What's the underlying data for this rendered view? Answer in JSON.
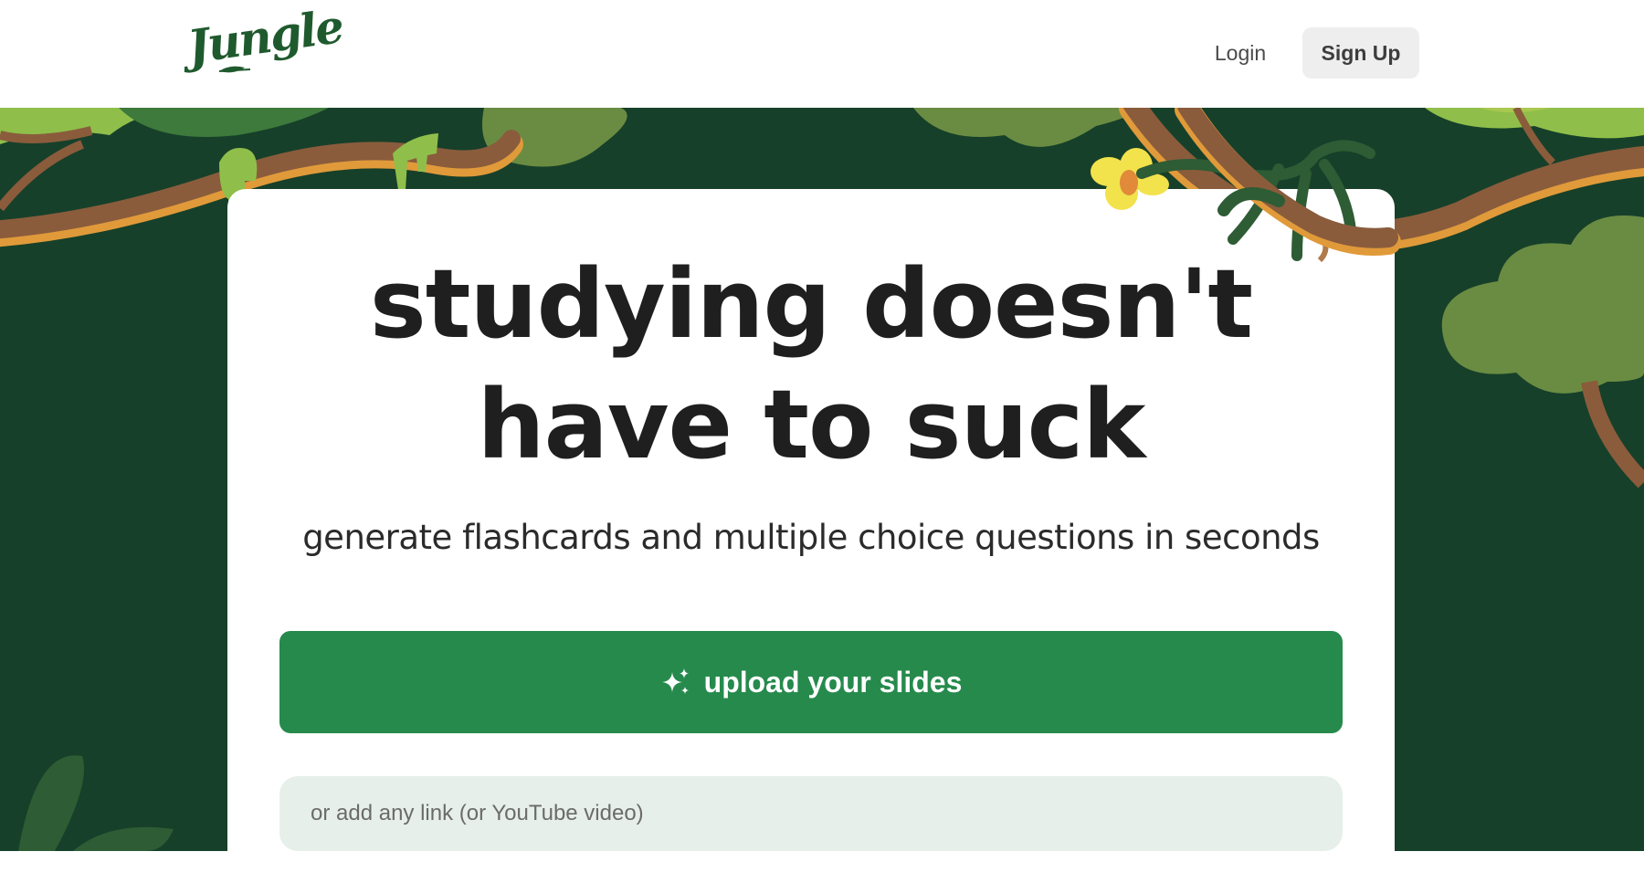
{
  "brand": {
    "logo_text": "Jungle"
  },
  "nav": {
    "login_label": "Login",
    "signup_label": "Sign Up"
  },
  "hero": {
    "headline_line1": "studying doesn't",
    "headline_line2": "have to suck",
    "subheadline": "generate flashcards and multiple choice questions in seconds",
    "upload_button_label": "upload your slides",
    "upload_button_icon": "sparkles-icon",
    "link_input_placeholder": "or add any link (or YouTube video)",
    "link_input_value": ""
  },
  "colors": {
    "background_dark": "#17402a",
    "button_green": "#268a4c",
    "input_bg": "#e6efe9",
    "text_dark": "#1f1f1f"
  }
}
